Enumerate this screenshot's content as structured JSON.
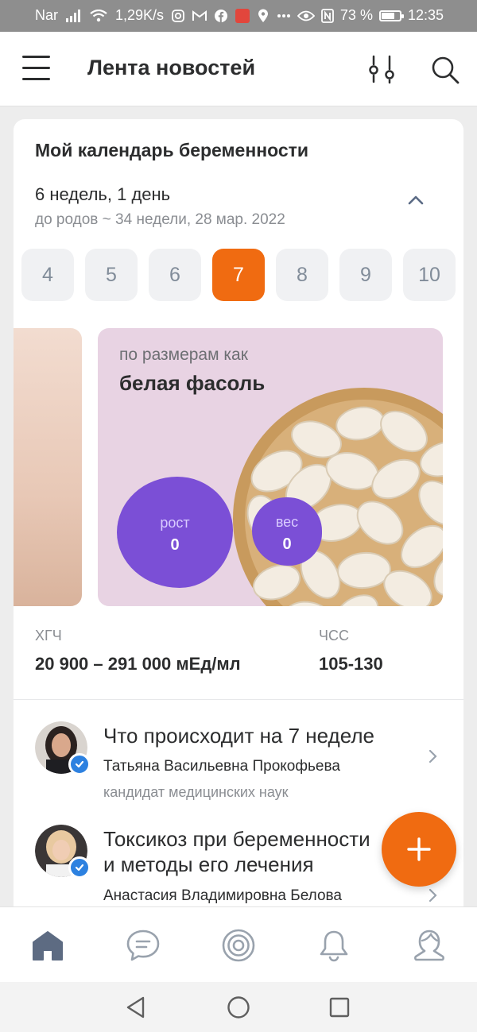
{
  "status_bar": {
    "carrier": "Nar",
    "speed": "1,29K/s",
    "battery": "73 %",
    "battery_level": 0.73,
    "time": "12:35"
  },
  "header": {
    "title": "Лента новостей",
    "icons": [
      "menu-icon",
      "filter-icon",
      "search-icon"
    ]
  },
  "calendar": {
    "title": "Мой календарь беременности",
    "current": "6 недель, 1 день",
    "due": "до родов ~ 34 недели, 28 мар. 2022",
    "weeks": [
      "4",
      "5",
      "6",
      "7",
      "8",
      "9",
      "10"
    ],
    "selected_week": "7",
    "slide": {
      "hint": "по размерам как",
      "name": "белая фасоль",
      "height_label": "рост",
      "height_value": "0",
      "weight_label": "вес",
      "weight_value": "0"
    },
    "metrics": [
      {
        "label": "ХГЧ",
        "value": "20 900 – 291 000 мЕд/мл"
      },
      {
        "label": "ЧСС",
        "value": "105-130"
      }
    ]
  },
  "articles": [
    {
      "title": "Что происходит на 7 неделе",
      "author": "Татьяна Васильевна Прокофьева",
      "role": "кандидат медицинских наук"
    },
    {
      "title_line1": "Токсикоз при беременности",
      "title_line2": "и методы его лечения",
      "author": "Анастасия Владимировна Белова"
    }
  ],
  "colors": {
    "accent": "#f06b11",
    "purple": "#7b4fd6",
    "slide_bg": "#e8d3e3",
    "verified": "#2d81e0"
  },
  "tabbar": [
    "home-icon",
    "messages-icon",
    "target-icon",
    "notifications-icon",
    "profile-icon"
  ],
  "navbar": [
    "back-icon",
    "home-circle-icon",
    "recents-icon"
  ]
}
